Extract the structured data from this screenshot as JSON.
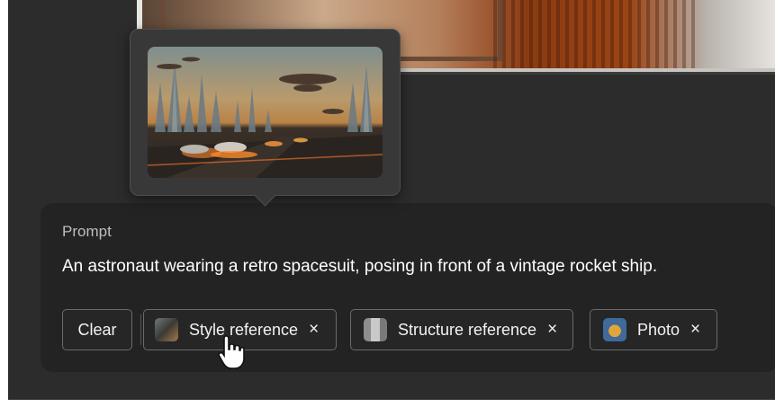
{
  "prompt": {
    "label": "Prompt",
    "text": "An astronaut wearing a retro spacesuit, posing in front of a vintage rocket ship."
  },
  "chips": {
    "clear": "Clear",
    "style_reference": "Style reference",
    "structure_reference": "Structure reference",
    "photo": "Photo",
    "remove_glyph": "×"
  },
  "icons": {
    "style_thumb": "style-reference-thumbnail-icon",
    "structure_thumb": "structure-reference-thumbnail-icon",
    "photo_thumb": "photo-thumbnail-icon",
    "remove": "close-icon",
    "cursor": "hand-pointer-cursor-icon"
  }
}
